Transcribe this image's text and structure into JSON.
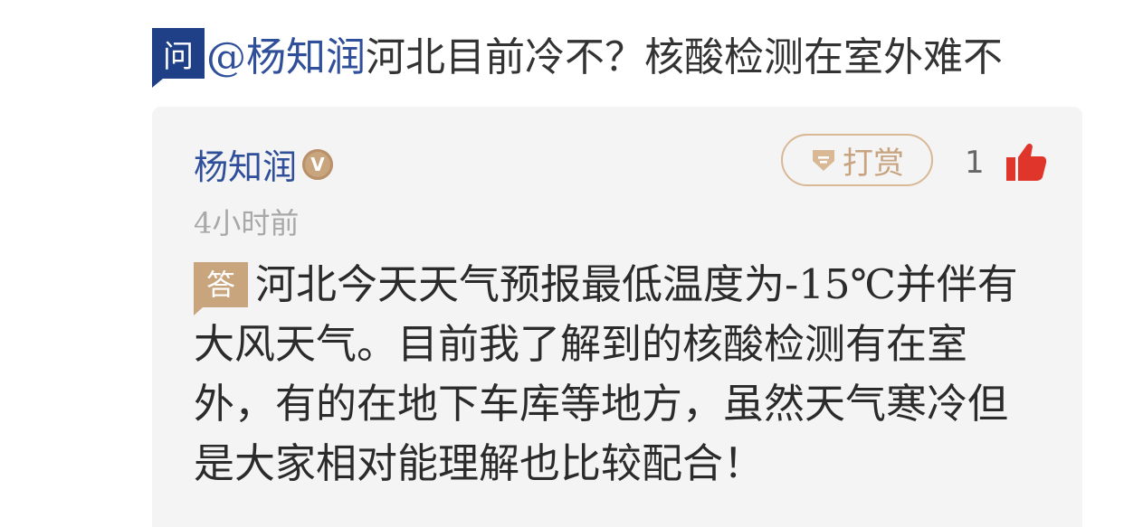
{
  "question": {
    "badge": "问",
    "mention": "@杨知润",
    "text": "河北目前冷不？核酸检测在室外难不"
  },
  "answer_card": {
    "author_name": "杨知润",
    "verified_badge": "V",
    "time": "4小时前",
    "tip_label": "打赏",
    "like_count": "1",
    "answer_badge": "答",
    "answer_text": "河北今天天气预报最低温度为-15℃并伴有大风天气。目前我了解到的核酸检测有在室外，有的在地下车库等地方，虽然天气寒冷但是大家相对能理解也比较配合！"
  },
  "icons": {
    "tip": "diamond-tip-icon",
    "like": "thumbs-up-icon",
    "verified": "verified-v-icon"
  },
  "colors": {
    "question_badge": "#1f3f87",
    "mention": "#2f4f9a",
    "accent_gold": "#c9a57d",
    "like_red": "#e0352b",
    "card_bg": "#f4f4f4"
  }
}
